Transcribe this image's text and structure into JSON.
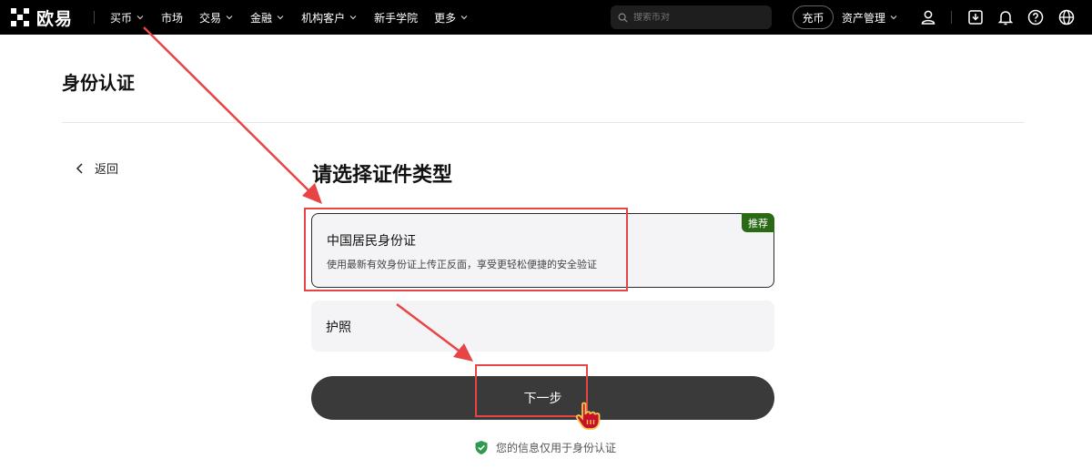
{
  "nav": {
    "logo_text": "欧易",
    "items": [
      {
        "label": "买币",
        "has_caret": true
      },
      {
        "label": "市场",
        "has_caret": false
      },
      {
        "label": "交易",
        "has_caret": true
      },
      {
        "label": "金融",
        "has_caret": true
      },
      {
        "label": "机构客户",
        "has_caret": true
      },
      {
        "label": "新手学院",
        "has_caret": false
      },
      {
        "label": "更多",
        "has_caret": true
      }
    ],
    "search_placeholder": "搜索币对",
    "deposit_label": "充币",
    "assets_label": "资产管理",
    "icons": [
      "user-icon",
      "download-icon",
      "bell-icon",
      "help-icon",
      "globe-icon"
    ]
  },
  "page": {
    "title": "身份认证",
    "back_label": "返回",
    "section_title": "请选择证件类型"
  },
  "options": [
    {
      "title": "中国居民身份证",
      "desc": "使用最新有效身份证上传正反面，享受更轻松便捷的安全验证",
      "badge": "推荐",
      "selected": true
    },
    {
      "title": "护照",
      "selected": false
    }
  ],
  "next_button_label": "下一步",
  "privacy_note": "您的信息仅用于身份认证",
  "colors": {
    "topbar_bg": "#000000",
    "badge_green": "#2b6a14",
    "annotation_red": "#e74545",
    "button_dark": "#3a3a3a",
    "card_bg": "#f4f3f5"
  }
}
